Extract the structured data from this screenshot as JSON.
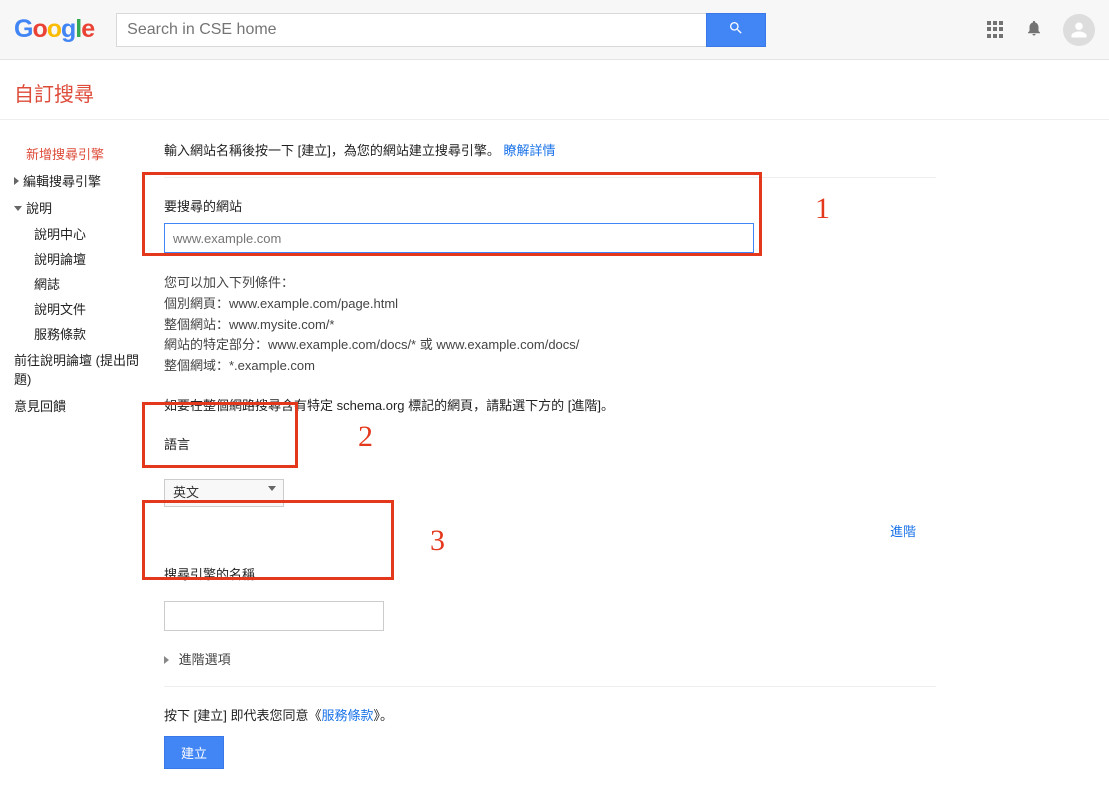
{
  "header": {
    "search_placeholder": "Search in CSE home",
    "logo_letters": [
      {
        "t": "G",
        "c": "#4285f4"
      },
      {
        "t": "o",
        "c": "#ea4335"
      },
      {
        "t": "o",
        "c": "#fbbc05"
      },
      {
        "t": "g",
        "c": "#4285f4"
      },
      {
        "t": "l",
        "c": "#34a853"
      },
      {
        "t": "e",
        "c": "#ea4335"
      }
    ]
  },
  "page_title": "自訂搜尋",
  "sidebar": {
    "new_engine": "新增搜尋引擎",
    "edit_engine": "編輯搜尋引擎",
    "help": "說明",
    "help_items": [
      "說明中心",
      "說明論壇",
      "網誌",
      "說明文件",
      "服務條款"
    ],
    "forum": "前往說明論壇 (提出問題)",
    "feedback": "意見回饋"
  },
  "main": {
    "intro_text": "輸入網站名稱後按一下 [建立]，為您的網站建立搜尋引擎。",
    "learn_more": "瞭解詳情",
    "sites_label": "要搜尋的網站",
    "sites_placeholder": "www.example.com",
    "conditions_intro": "您可以加入下列條件：",
    "conditions": [
      "個別網頁：www.example.com/page.html",
      "整個網站：www.mysite.com/*",
      "網站的特定部分：www.example.com/docs/* 或 www.example.com/docs/",
      "整個網域：*.example.com"
    ],
    "schema_note": "如要在整個網路搜尋含有特定 schema.org 標記的網頁，請點選下方的 [進階]。",
    "language_label": "語言",
    "language_value": "英文",
    "advanced_link": "進階",
    "name_label": "搜尋引擎的名稱",
    "advanced_toggle": "進階選項",
    "tos_pre": "按下 [建立] 即代表您同意《",
    "tos_link": "服務條款",
    "tos_post": "》。",
    "create_button": "建立"
  },
  "annotations": {
    "n1": "1",
    "n2": "2",
    "n3": "3"
  }
}
